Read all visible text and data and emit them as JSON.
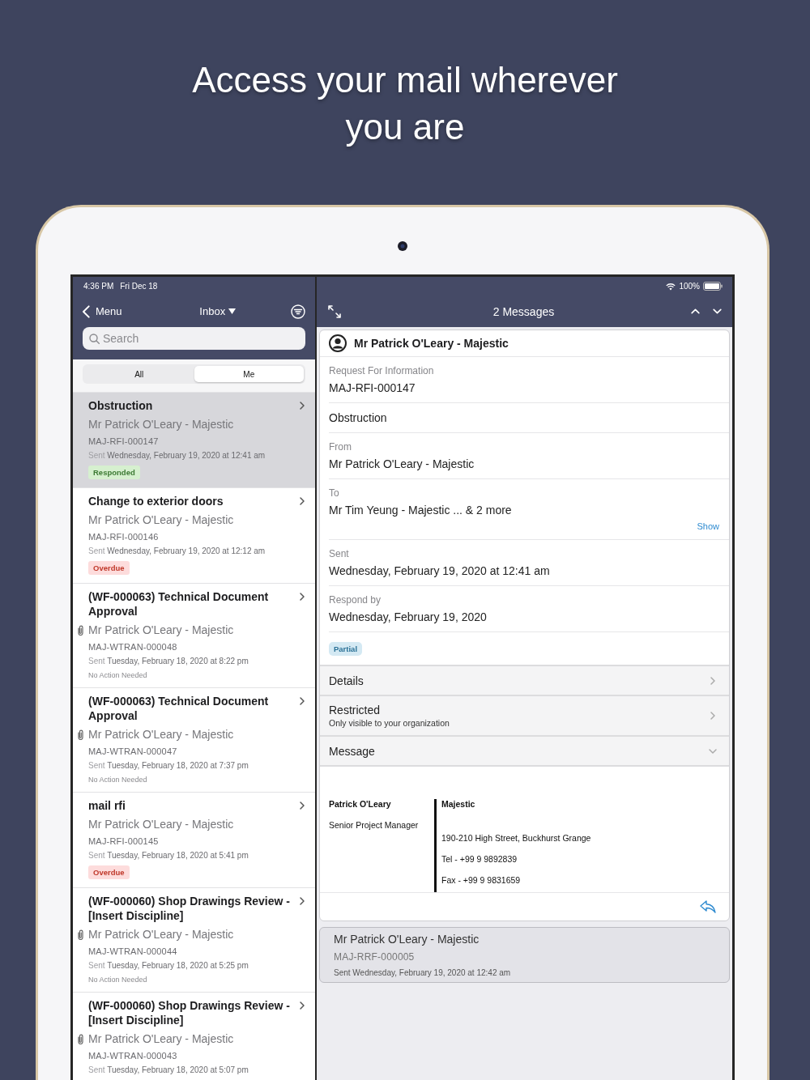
{
  "headline": "Access your mail wherever you are",
  "status_bar": {
    "time": "4:36 PM",
    "date": "Fri Dec 18",
    "battery": "100%"
  },
  "list_pane": {
    "back_label": "Menu",
    "mailbox": "Inbox",
    "search": {
      "placeholder": "Search"
    },
    "segments": [
      {
        "label": "All",
        "selected": false
      },
      {
        "label": "Me",
        "selected": true
      }
    ],
    "items": [
      {
        "title": "Obstruction",
        "sender": "Mr Patrick O'Leary - Majestic",
        "attachment": false,
        "ref": "MAJ-RFI-000147",
        "sent_label": "Sent",
        "sent": "Wednesday, February 19, 2020 at 12:41 am",
        "status": {
          "kind": "badge",
          "text": "Responded",
          "color": "#d6f0cf"
        },
        "selected": true
      },
      {
        "title": "Change to exterior doors",
        "sender": "Mr Patrick O'Leary - Majestic",
        "attachment": false,
        "ref": "MAJ-RFI-000146",
        "sent_label": "Sent",
        "sent": "Wednesday, February 19, 2020 at 12:12 am",
        "status": {
          "kind": "badge",
          "text": "Overdue",
          "color": "#fddcdc"
        },
        "selected": false
      },
      {
        "title": "(WF-000063) Technical Document Approval",
        "sender": "Mr Patrick O'Leary - Majestic",
        "attachment": true,
        "ref": "MAJ-WTRAN-000048",
        "sent_label": "Sent",
        "sent": "Tuesday, February 18, 2020 at 8:22 pm",
        "status": {
          "kind": "note",
          "text": "No Action Needed"
        },
        "selected": false
      },
      {
        "title": "(WF-000063) Technical Document Approval",
        "sender": "Mr Patrick O'Leary - Majestic",
        "attachment": true,
        "ref": "MAJ-WTRAN-000047",
        "sent_label": "Sent",
        "sent": "Tuesday, February 18, 2020 at 7:37 pm",
        "status": {
          "kind": "note",
          "text": "No Action Needed"
        },
        "selected": false
      },
      {
        "title": "mail rfi",
        "sender": "Mr Patrick O'Leary - Majestic",
        "attachment": false,
        "ref": "MAJ-RFI-000145",
        "sent_label": "Sent",
        "sent": "Tuesday, February 18, 2020 at 5:41 pm",
        "status": {
          "kind": "badge",
          "text": "Overdue",
          "color": "#fddcdc"
        },
        "selected": false
      },
      {
        "title": "(WF-000060) Shop Drawings Review - [Insert Discipline]",
        "sender": "Mr Patrick O'Leary - Majestic",
        "attachment": true,
        "ref": "MAJ-WTRAN-000044",
        "sent_label": "Sent",
        "sent": "Tuesday, February 18, 2020 at 5:25 pm",
        "status": {
          "kind": "note",
          "text": "No Action Needed"
        },
        "selected": false
      },
      {
        "title": "(WF-000060) Shop Drawings Review - [Insert Discipline]",
        "sender": "Mr Patrick O'Leary - Majestic",
        "attachment": true,
        "ref": "MAJ-WTRAN-000043",
        "sent_label": "Sent",
        "sent": "Tuesday, February 18, 2020 at 5:07 pm",
        "selected": false
      }
    ]
  },
  "detail_pane": {
    "title": "2 Messages",
    "message": {
      "sender": "Mr Patrick O'Leary - Majestic",
      "fields": [
        {
          "label": "Request For Information",
          "value": "MAJ-RFI-000147"
        },
        {
          "value": "Obstruction"
        },
        {
          "label": "From",
          "value": "Mr Patrick O'Leary - Majestic"
        },
        {
          "label": "To",
          "value": "Mr Tim Yeung - Majestic ... &  2  more",
          "link": "Show"
        },
        {
          "label": "Sent",
          "value": "Wednesday, February 19, 2020 at 12:41 am"
        },
        {
          "label": "Respond by",
          "value": "Wednesday, February 19, 2020"
        }
      ],
      "status": {
        "text": "Partial",
        "color": "#d4e9f3"
      },
      "sections": [
        {
          "title": "Details",
          "expanded": false
        },
        {
          "title": "Restricted",
          "subtitle": "Only visible to your organization",
          "expanded": false
        },
        {
          "title": "Message",
          "expanded": true
        }
      ],
      "signature": {
        "name": "Patrick O'Leary",
        "role": "Senior Project Manager",
        "company": "Majestic",
        "lines": [
          "190-210 High Street, Buckhurst Grange",
          "Tel - +99 9 9892839",
          "Fax - +99 9 9831659"
        ]
      }
    },
    "other_messages": [
      {
        "sender": "Mr Patrick O'Leary - Majestic",
        "ref": "MAJ-RRF-000005",
        "sent_label": "Sent",
        "sent": "Wednesday, February 19, 2020 at 12:42 am"
      }
    ]
  }
}
